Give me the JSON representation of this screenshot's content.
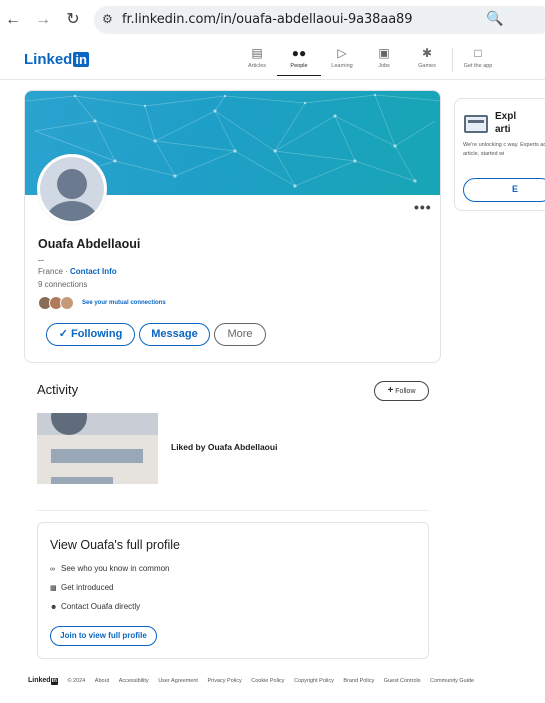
{
  "browser": {
    "back_icon": "arrow-left-icon",
    "forward_icon": "arrow-right-icon",
    "reload_icon": "reload-icon",
    "url": "fr.linkedin.com/in/ouafa-abdellaoui-9a38aa89"
  },
  "nav": {
    "logo_text": "Linked",
    "logo_badge": "in",
    "items": [
      {
        "label": "Articles",
        "icon": "articles-icon"
      },
      {
        "label": "People",
        "icon": "people-icon"
      },
      {
        "label": "Learning",
        "icon": "learning-icon"
      },
      {
        "label": "Jobs",
        "icon": "jobs-icon"
      },
      {
        "label": "Games",
        "icon": "games-icon"
      },
      {
        "label": "Get the app",
        "icon": "laptop-icon"
      }
    ],
    "active": "People"
  },
  "profile": {
    "name": "Ouafa Abdellaoui",
    "headline": "--",
    "location": "France",
    "separator": " · ",
    "contact_info": "Contact Info",
    "connections": "9 connections",
    "mutual": "See your mutual connections",
    "following": "Following",
    "following_check": "✓",
    "message": "Message",
    "more": "More",
    "more_dots": "•••"
  },
  "side_card": {
    "title": "Expl\narti",
    "description": "We're unlocking c way. Experts add article, started wi",
    "button": "E"
  },
  "activity": {
    "title": "Activity",
    "follow_plus": "+",
    "follow": "Follow",
    "item_text": "Liked by Ouafa Abdellaoui"
  },
  "full_profile": {
    "title": "View Ouafa's full profile",
    "rows": [
      {
        "icon": "link-icon",
        "text": "See who you know in common"
      },
      {
        "icon": "introduce-icon",
        "text": "Get introduced"
      },
      {
        "icon": "contact-icon",
        "text": "Contact Ouafa directly"
      }
    ],
    "join_button": "Join to view full profile"
  },
  "footer": {
    "logo_text": "Linked",
    "logo_badge": "in",
    "copyright": "© 2024",
    "links": [
      "About",
      "Accessibility",
      "User Agreement",
      "Privacy Policy",
      "Cookie Policy",
      "Copyright Policy",
      "Brand Policy",
      "Guest Controls",
      "Community Guide"
    ]
  },
  "colors": {
    "brand": "#0a66c2",
    "banner": "#1e9fc7"
  }
}
